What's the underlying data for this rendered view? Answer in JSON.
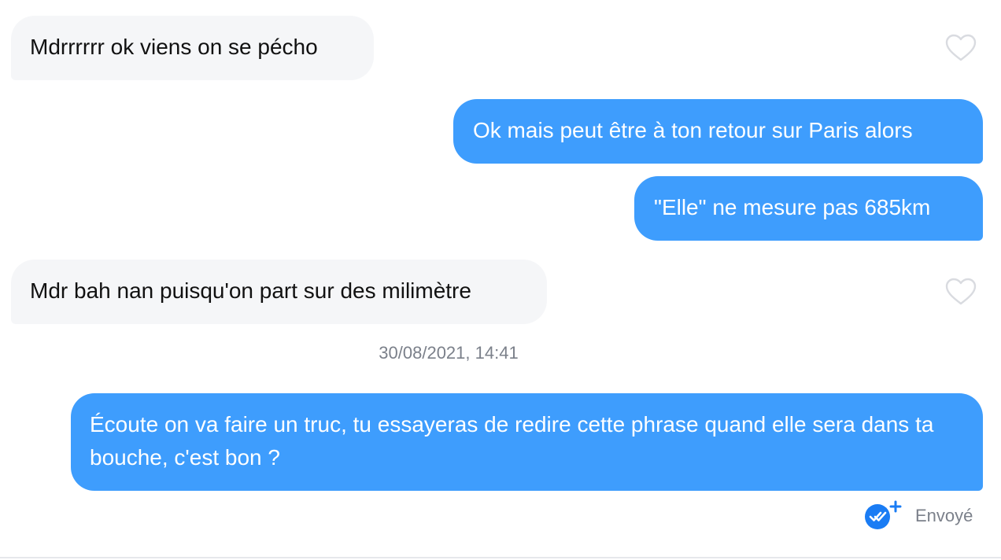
{
  "messages": [
    {
      "direction": "incoming",
      "text": "Mdrrrrrr ok viens on se pécho"
    },
    {
      "direction": "outgoing",
      "text": "Ok mais peut être à ton retour sur Paris alors"
    },
    {
      "direction": "outgoing",
      "text": "\"Elle\" ne mesure pas 685km"
    },
    {
      "direction": "incoming",
      "text": "Mdr bah nan puisqu'on part sur des milimètre"
    },
    {
      "direction": "outgoing",
      "text": "Écoute on va faire un truc, tu essayeras de redire cette phrase quand elle sera dans ta bouche, c'est bon ?"
    }
  ],
  "timestamp": "30/08/2021, 14:41",
  "status": {
    "label": "Envoyé",
    "icon": "double-check-plus-icon"
  },
  "icons": {
    "like": "heart-outline-icon"
  },
  "colors": {
    "incoming_bubble": "#f5f6f8",
    "outgoing_bubble": "#3e9dfd",
    "status_icon": "#1a7cf4",
    "heart": "#d9dbe0",
    "meta_text": "#7b808a"
  }
}
